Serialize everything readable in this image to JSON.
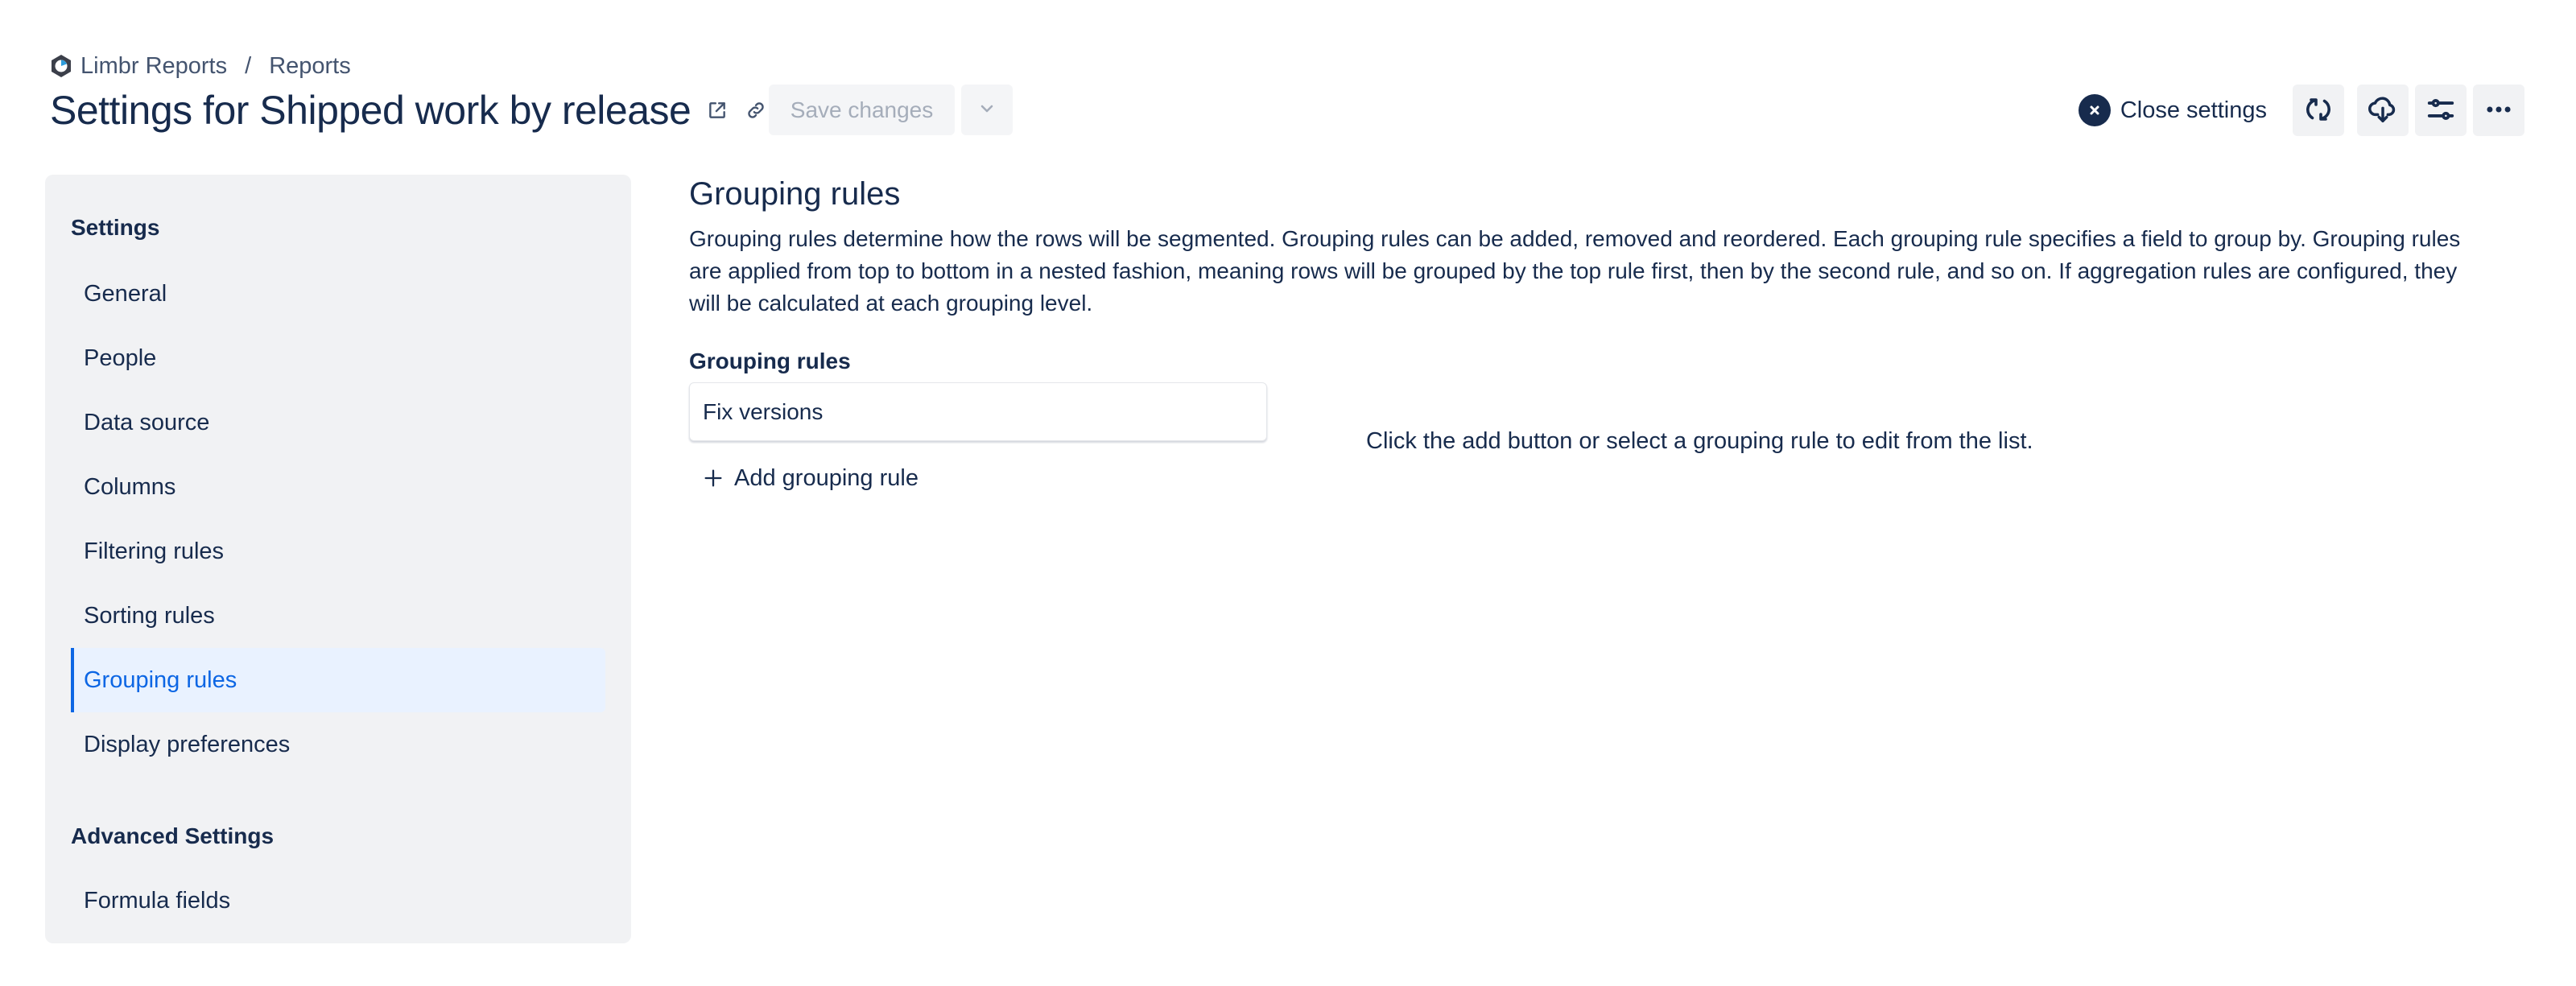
{
  "breadcrumb": {
    "app_name": "Limbr Reports",
    "separator": "/",
    "section": "Reports"
  },
  "header": {
    "title": "Settings for Shipped work by release",
    "save_label": "Save changes",
    "close_settings_label": "Close settings"
  },
  "icons": {
    "logo": "limbr-logo-icon",
    "open_external": "external-link-icon",
    "copy_link": "link-icon",
    "save_menu": "chevron-down-icon",
    "close": "close-icon",
    "refresh": "refresh-icon",
    "export": "cloud-download-icon",
    "filters": "sliders-icon",
    "more": "more-horizontal-icon",
    "add": "plus-icon"
  },
  "sidebar": {
    "settings_heading": "Settings",
    "items": [
      {
        "label": "General",
        "active": false
      },
      {
        "label": "People",
        "active": false
      },
      {
        "label": "Data source",
        "active": false
      },
      {
        "label": "Columns",
        "active": false
      },
      {
        "label": "Filtering rules",
        "active": false
      },
      {
        "label": "Sorting rules",
        "active": false
      },
      {
        "label": "Grouping rules",
        "active": true
      },
      {
        "label": "Display preferences",
        "active": false
      }
    ],
    "advanced_heading": "Advanced Settings",
    "advanced_items": [
      {
        "label": "Formula fields",
        "active": false
      }
    ]
  },
  "main": {
    "heading": "Grouping rules",
    "description": "Grouping rules determine how the rows will be segmented. Grouping rules can be added, removed and reordered. Each grouping rule specifies a field to group by. Grouping rules are applied from top to bottom in a nested fashion, meaning rows will be grouped by the top rule first, then by the second rule, and so on. If aggregation rules are configured, they will be calculated at each grouping level.",
    "rules_label": "Grouping rules",
    "rules": [
      {
        "label": "Fix versions"
      }
    ],
    "add_rule_label": "Add grouping rule",
    "empty_hint": "Click the add button or select a grouping rule to edit from the list."
  },
  "colors": {
    "text_primary": "#172B4D",
    "accent": "#0C66E4",
    "active_bg": "#E9F2FF",
    "sidebar_bg": "#F1F2F4",
    "disabled_text": "#A5ADBA"
  }
}
